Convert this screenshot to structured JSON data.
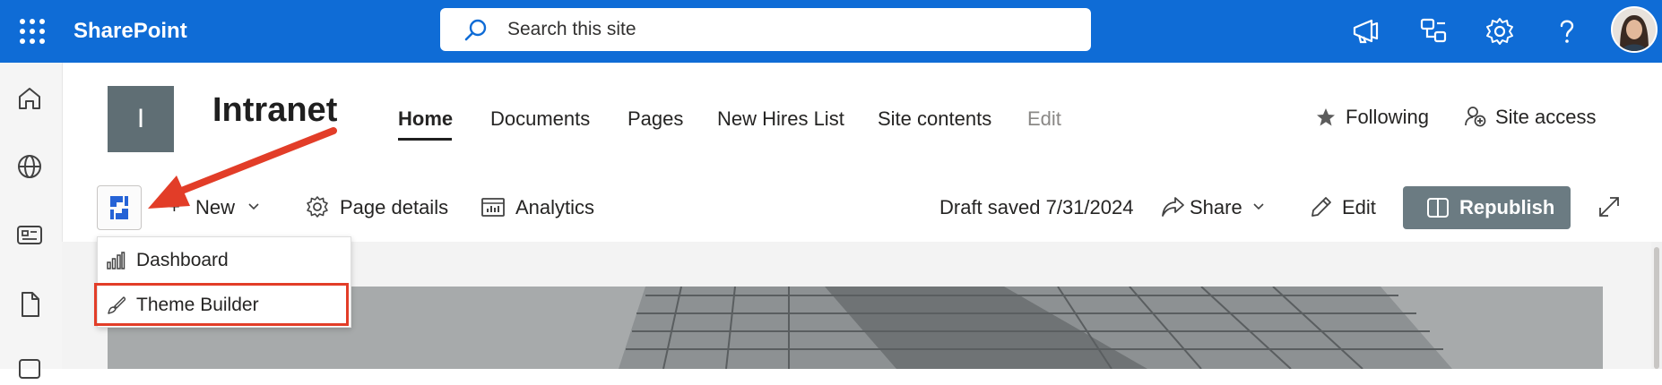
{
  "topbar": {
    "brand": "SharePoint",
    "search_placeholder": "Search this site",
    "color": "#0f6cd6",
    "icons": [
      "waffle-icon",
      "megaphone-icon",
      "org-chart-icon",
      "gear-icon",
      "help-icon",
      "avatar"
    ]
  },
  "rail": {
    "icons": [
      "home-icon",
      "globe-icon",
      "news-icon",
      "document-icon",
      "more-icon"
    ]
  },
  "site": {
    "logo_letter": "I",
    "title": "Intranet",
    "nav": [
      "Home",
      "Documents",
      "Pages",
      "New Hires List",
      "Site contents",
      "Edit"
    ],
    "active_nav": "Home",
    "following": "Following",
    "site_access": "Site access"
  },
  "command_bar": {
    "new": "New",
    "page_details": "Page details",
    "analytics": "Analytics",
    "draft_saved": "Draft saved 7/31/2024",
    "share": "Share",
    "edit": "Edit",
    "republish": "Republish"
  },
  "dropdown": {
    "items": [
      {
        "label": "Dashboard",
        "icon": "bar-chart-icon"
      },
      {
        "label": "Theme Builder",
        "icon": "paintbrush-icon"
      }
    ],
    "highlighted": "Theme Builder"
  },
  "annotation": {
    "arrow_color": "#e23d28",
    "highlight_color": "#e23d28"
  }
}
